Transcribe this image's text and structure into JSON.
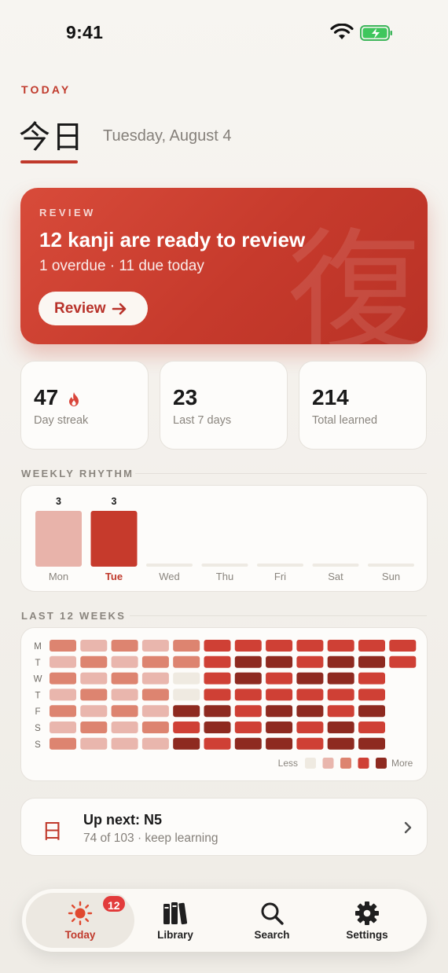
{
  "status_bar": {
    "time": "9:41"
  },
  "header": {
    "eyebrow": "TODAY",
    "kanji_title": "今日",
    "date": "Tuesday, August 4"
  },
  "review_card": {
    "eyebrow": "REVIEW",
    "heading": "12 kanji are ready to review",
    "subtitle": "1 overdue · 11 due today",
    "watermark": "復",
    "button_label": "Review"
  },
  "stats": [
    {
      "value": "47",
      "label": "Day streak",
      "icon": "flame-icon"
    },
    {
      "value": "23",
      "label": "Last 7 days"
    },
    {
      "value": "214",
      "label": "Total learned"
    }
  ],
  "weekly_rhythm": {
    "title": "WEEKLY RHYTHM",
    "days": [
      "Mon",
      "Tue",
      "Wed",
      "Thu",
      "Fri",
      "Sat",
      "Sun"
    ],
    "values": [
      3,
      3,
      0,
      0,
      0,
      0,
      0
    ],
    "today_index": 1,
    "max": 3
  },
  "heatmap": {
    "title": "LAST 12 WEEKS",
    "row_labels": [
      "M",
      "T",
      "W",
      "T",
      "F",
      "S",
      "S"
    ],
    "colors": [
      "#efeae1",
      "#e9b6ad",
      "#dd8470",
      "#cf4035",
      "#8e2a20"
    ],
    "legend_less": "Less",
    "legend_more": "More",
    "grid": [
      [
        2,
        1,
        2,
        1,
        2,
        3,
        3,
        3,
        3,
        3,
        3,
        3
      ],
      [
        1,
        2,
        1,
        2,
        2,
        3,
        4,
        4,
        3,
        4,
        4,
        3
      ],
      [
        2,
        1,
        2,
        1,
        0,
        3,
        4,
        3,
        4,
        4,
        3,
        null
      ],
      [
        1,
        2,
        1,
        2,
        0,
        3,
        3,
        3,
        3,
        3,
        3,
        null
      ],
      [
        2,
        1,
        2,
        1,
        4,
        4,
        3,
        4,
        4,
        3,
        4,
        null
      ],
      [
        1,
        2,
        1,
        2,
        3,
        4,
        3,
        4,
        3,
        4,
        3,
        null
      ],
      [
        2,
        1,
        1,
        1,
        4,
        3,
        4,
        4,
        3,
        4,
        4,
        null
      ]
    ]
  },
  "up_next": {
    "glyph": "日",
    "title": "Up next: N5",
    "subtitle": "74 of 103 · keep learning"
  },
  "tab_bar": {
    "tabs": [
      {
        "label": "Today",
        "icon": "sun-icon",
        "badge": "12",
        "active": true
      },
      {
        "label": "Library",
        "icon": "books-icon"
      },
      {
        "label": "Search",
        "icon": "search-icon"
      },
      {
        "label": "Settings",
        "icon": "gear-icon"
      }
    ]
  },
  "theme": {
    "accent": "#c0392b"
  }
}
